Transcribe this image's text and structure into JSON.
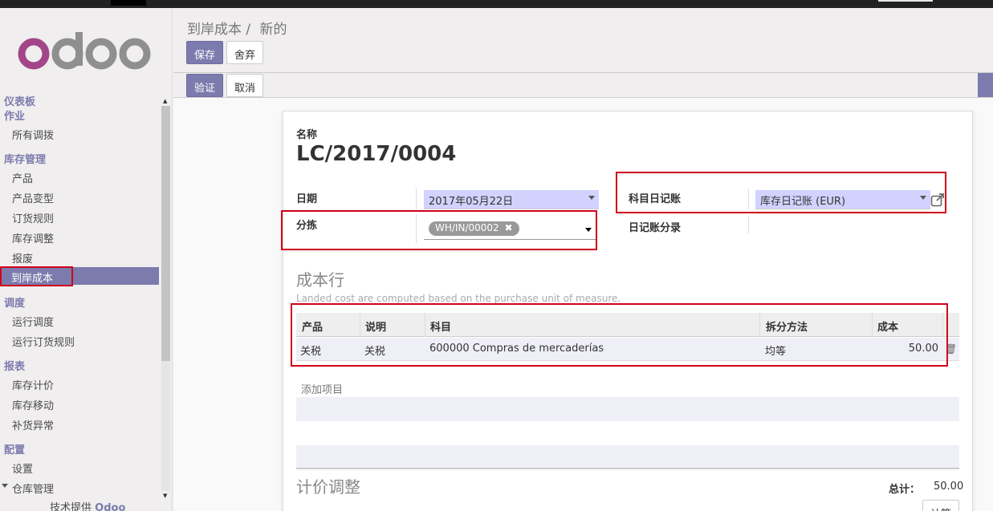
{
  "app": {
    "logo_text": "odoo",
    "powered_prefix": "技术提供",
    "powered_brand": "Odoo"
  },
  "sidebar": {
    "sections": [
      {
        "title": "仪表板",
        "items": []
      },
      {
        "title": "作业",
        "items": [
          "所有调拨"
        ]
      },
      {
        "title": "库存管理",
        "items": [
          "产品",
          "产品变型",
          "订货规则",
          "库存调整",
          "报废",
          "到岸成本"
        ]
      },
      {
        "title": "调度",
        "items": [
          "运行调度",
          "运行订货规则"
        ]
      },
      {
        "title": "报表",
        "items": [
          "库存计价",
          "库存移动",
          "补货异常"
        ]
      },
      {
        "title": "配置",
        "items": [
          "设置",
          "仓库管理"
        ]
      }
    ],
    "active_item": "到岸成本"
  },
  "breadcrumb": {
    "parent": "到岸成本",
    "separator": "/",
    "current": "新的"
  },
  "toolbar": {
    "save_label": "保存",
    "discard_label": "舍弃"
  },
  "statusbar": {
    "validate_label": "验证",
    "cancel_label": "取消"
  },
  "form": {
    "name_label": "名称",
    "name_value": "LC/2017/0004",
    "date_label": "日期",
    "date_value": "2017年05月22日",
    "picking_label": "分拣",
    "picking_tag": "WH/IN/00002",
    "journal_label": "科目日记账",
    "journal_value": "库存日记账 (EUR)",
    "move_label": "日记账分录"
  },
  "cost_lines": {
    "section_title": "成本行",
    "hint": "Landed cost are computed based on the purchase unit of measure.",
    "columns": [
      "产品",
      "说明",
      "科目",
      "拆分方法",
      "成本"
    ],
    "rows": [
      {
        "product": "关税",
        "description": "关税",
        "account": "600000 Compras de mercaderías",
        "split": "均等",
        "cost": "50.00"
      }
    ],
    "add_line": "添加项目"
  },
  "valuation": {
    "section_title": "计价调整",
    "total_label": "总计：",
    "total_value": "50.00",
    "compute_label": "计算"
  },
  "colors": {
    "accent": "#7c7bad",
    "highlight": "#d0021b",
    "select_bg": "#d2d2ff"
  }
}
